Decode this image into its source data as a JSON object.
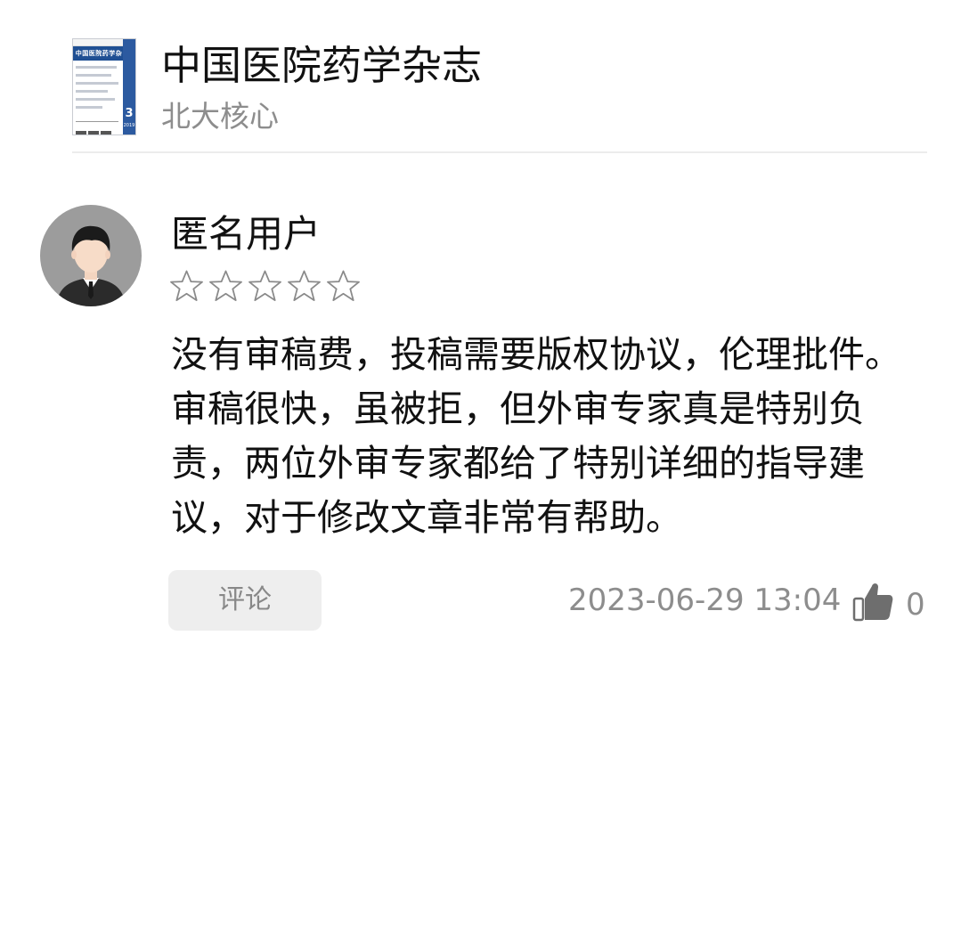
{
  "journal": {
    "title": "中国医院药学杂志",
    "tag": "北大核心",
    "cover": {
      "banner_text": "中国医院药学杂志",
      "issue_number": "3",
      "year": "2019",
      "accent_color": "#1f4f93"
    }
  },
  "review": {
    "username": "匿名用户",
    "rating": 0,
    "rating_max": 5,
    "text": "没有审稿费，投稿需要版权协议，伦理批件。审稿很快，虽被拒，但外审专家真是特别负责，两位外审专家都给了特别详细的指导建议，对于修改文章非常有帮助。",
    "comment_button_label": "评论",
    "timestamp": "2023-06-29 13:04",
    "like_count": "0",
    "icons": {
      "avatar": "user-avatar-icon",
      "star": "star-outline-icon",
      "like": "thumbs-up-icon"
    }
  },
  "colors": {
    "primary_text": "#111111",
    "secondary_text": "#8d8d8d",
    "button_bg": "#eeeeee",
    "divider": "#ececec",
    "avatar_bg": "#9c9c9c"
  }
}
